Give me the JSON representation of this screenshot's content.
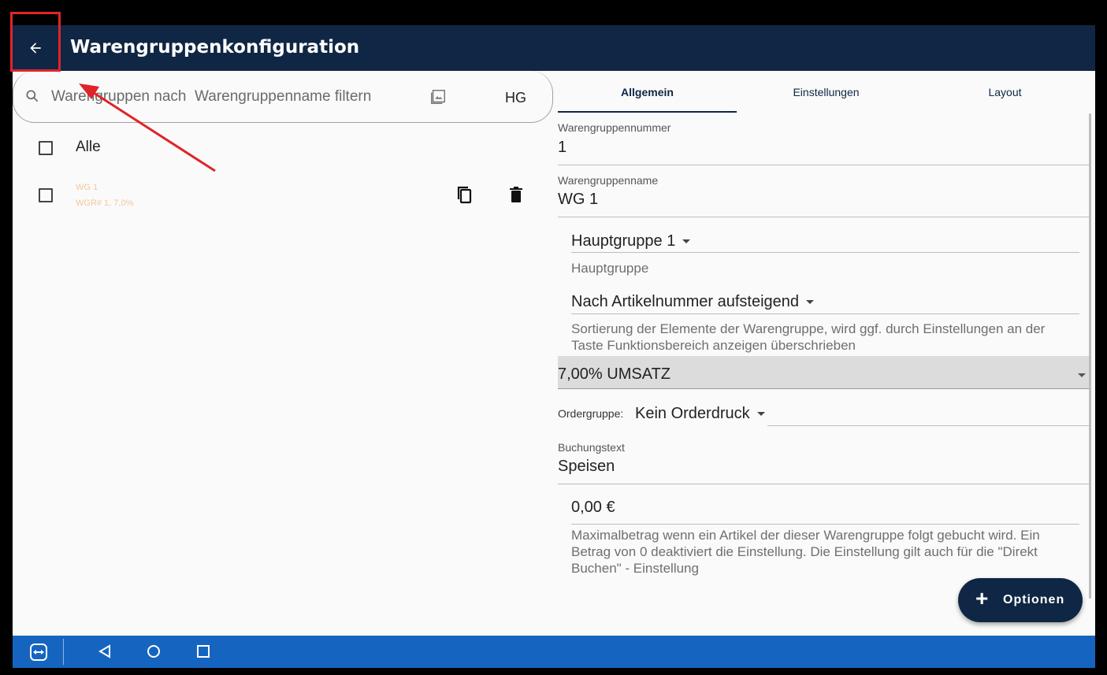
{
  "app_bar": {
    "title": "Warengruppenkonfiguration",
    "back_icon": "arrow-left-icon"
  },
  "search": {
    "placeholder": "Warengruppen nach  Warengruppenname filtern",
    "hg_label": "HG"
  },
  "list": {
    "all_label": "Alle",
    "items": [
      {
        "name": "WG 1",
        "details": "WGR# 1, 7,0%"
      }
    ]
  },
  "tabs": [
    {
      "label": "Allgemein",
      "active": true
    },
    {
      "label": "Einstellungen",
      "active": false
    },
    {
      "label": "Layout",
      "active": false
    }
  ],
  "form": {
    "group_number": {
      "label": "Warengruppennummer",
      "value": "1"
    },
    "group_name": {
      "label": "Warengruppenname",
      "value": "WG 1"
    },
    "main_group": {
      "value": "Hauptgruppe 1",
      "helper": "Hauptgruppe"
    },
    "sorting": {
      "value": "Nach Artikelnummer aufsteigend",
      "helper": "Sortierung der Elemente der Warengruppe, wird ggf. durch Einstellungen an der Taste Funktionsbereich anzeigen überschrieben"
    },
    "tax": {
      "value": "7,00% UMSATZ"
    },
    "order_group": {
      "label": "Ordergruppe:",
      "value": "Kein Orderdruck"
    },
    "booking_text": {
      "label": "Buchungstext",
      "value": "Speisen"
    },
    "max_amount": {
      "value": "0,00 €",
      "helper": "Maximalbetrag wenn ein Artikel der dieser Warengruppe folgt gebucht wird. Ein Betrag von 0 deaktiviert die Einstellung. Die Einstellung gilt auch für die \"Direkt Buchen\" - Einstellung"
    }
  },
  "fab": {
    "label": "Optionen"
  },
  "colors": {
    "primary": "#0f2744",
    "nav_bar": "#1565c0",
    "item_text": "#f5c79a",
    "annotation": "#e0242a"
  }
}
